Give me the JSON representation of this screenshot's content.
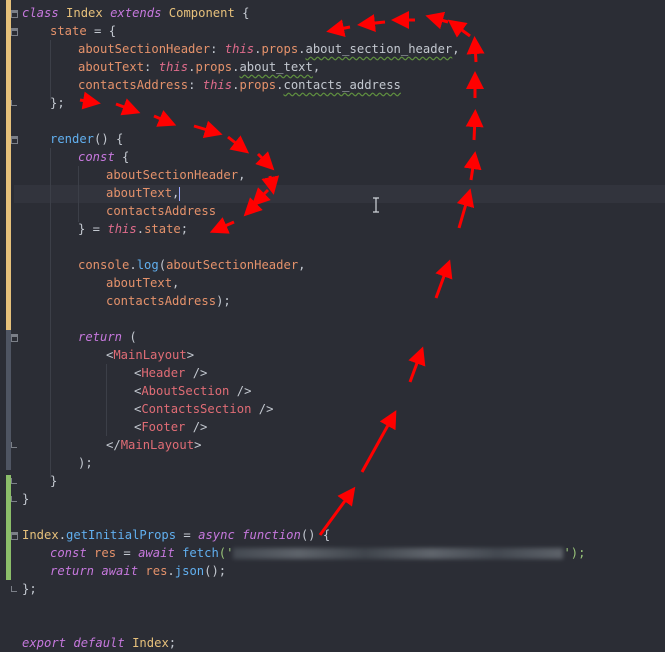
{
  "editor": {
    "lines": {
      "l1": [
        "class",
        " ",
        "Index",
        " ",
        "extends",
        " ",
        "Component",
        " {"
      ],
      "l2": [
        "state",
        " = {"
      ],
      "l3": [
        "aboutSectionHeader",
        ": ",
        "this",
        ".",
        "props",
        ".",
        "about_section_header",
        ","
      ],
      "l4": [
        "aboutText",
        ": ",
        "this",
        ".",
        "props",
        ".",
        "about_text",
        ","
      ],
      "l5": [
        "contactsAddress",
        ": ",
        "this",
        ".",
        "props",
        ".",
        "contacts_address"
      ],
      "l6": [
        "};"
      ],
      "l7": [
        "render",
        "() {"
      ],
      "l8": [
        "const",
        " {"
      ],
      "l9": [
        "aboutSectionHeader",
        ","
      ],
      "l10": [
        "aboutText",
        ","
      ],
      "l11": [
        "contactsAddress"
      ],
      "l12": [
        "} = ",
        "this",
        ".",
        "state",
        ";"
      ],
      "l13": [
        "console",
        ".",
        "log",
        "(",
        "aboutSectionHeader",
        ","
      ],
      "l14": [
        "aboutText",
        ","
      ],
      "l15": [
        "contactsAddress",
        ");"
      ],
      "l16": [
        "return",
        " ("
      ],
      "l17": [
        "<",
        "MainLayout",
        ">"
      ],
      "l18": [
        "<",
        "Header",
        " />"
      ],
      "l19": [
        "<",
        "AboutSection",
        " />"
      ],
      "l20": [
        "<",
        "ContactsSection",
        " />"
      ],
      "l21": [
        "<",
        "Footer",
        " />"
      ],
      "l22": [
        "</",
        "MainLayout",
        ">"
      ],
      "l23": [
        ");"
      ],
      "l24": [
        "}"
      ],
      "l25": [
        "}"
      ],
      "l26": [
        "Index",
        ".",
        "getInitialProps",
        " = ",
        "async",
        " ",
        "function",
        "() {"
      ],
      "l27": [
        "const",
        " ",
        "res",
        " = ",
        "await",
        " ",
        "fetch",
        "('",
        "",
        "');"
      ],
      "l28": [
        "return",
        " ",
        "await",
        " ",
        "res",
        ".",
        "json",
        "();"
      ],
      "l29": [
        "};"
      ],
      "l30": [
        "export",
        " ",
        "default",
        " ",
        "Index",
        ";"
      ]
    },
    "colors": {
      "background": "#2b2d35",
      "gutter_modified": "#e5c07b",
      "gutter_added": "#8bbd6a",
      "gutter_unchanged": "#4f5563",
      "annotation_arrows": "#ff0000"
    },
    "icons": {
      "cursor": "text-cursor-icon"
    }
  }
}
